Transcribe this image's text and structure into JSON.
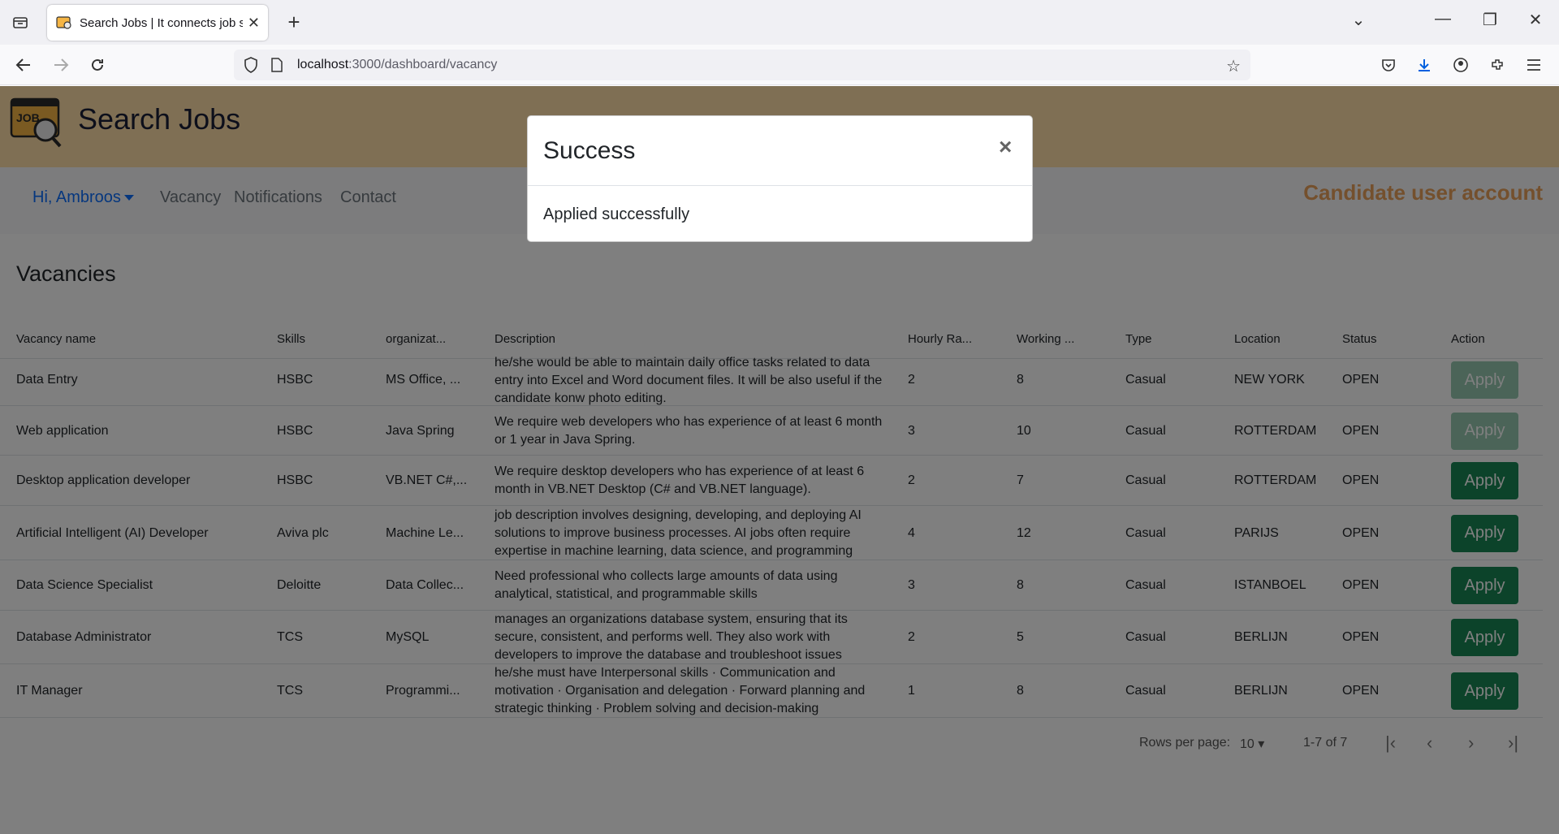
{
  "browser": {
    "tab_title": "Search Jobs | It connects job se",
    "url_host": "localhost",
    "url_path": ":3000/dashboard/vacancy"
  },
  "site": {
    "title": "Search Jobs",
    "logo_text": "JOB"
  },
  "menu": {
    "user": "Hi, Ambroos",
    "items": [
      "Vacancy",
      "Notifications",
      "Contact"
    ],
    "account_label": "Candidate user account"
  },
  "section_title": "Vacancies",
  "table": {
    "headers": [
      "Vacancy name",
      "Skills",
      "organizat...",
      "Description",
      "Hourly Ra...",
      "Working ...",
      "Type",
      "Location",
      "Status",
      "Action"
    ],
    "rows": [
      {
        "name": "Data Entry",
        "skills": "HSBC",
        "organization": "MS Office, ...",
        "description": "he/she would be able to maintain daily office tasks related to data entry into Excel and Word document files. It will be also useful if the candidate konw photo editing.",
        "rate": "2",
        "hours": "8",
        "type": "Casual",
        "location": "NEW YORK",
        "status": "OPEN",
        "action": "Apply",
        "applied": true
      },
      {
        "name": "Web application",
        "skills": "HSBC",
        "organization": "Java Spring",
        "description": "We require web developers who has experience of at least 6 month or 1 year in Java Spring.",
        "rate": "3",
        "hours": "10",
        "type": "Casual",
        "location": "ROTTERDAM",
        "status": "OPEN",
        "action": "Apply",
        "applied": true
      },
      {
        "name": "Desktop application developer",
        "skills": "HSBC",
        "organization": "VB.NET C#,...",
        "description": "We require desktop developers who has experience of at least 6 month in VB.NET Desktop (C# and VB.NET language).",
        "rate": "2",
        "hours": "7",
        "type": "Casual",
        "location": "ROTTERDAM",
        "status": "OPEN",
        "action": "Apply",
        "applied": false
      },
      {
        "name": "Artificial Intelligent (AI) Developer",
        "skills": "Aviva plc",
        "organization": "Machine Le...",
        "description": "job description involves designing, developing, and deploying AI solutions to improve business processes. AI jobs often require expertise in machine learning, data science, and programming",
        "rate": "4",
        "hours": "12",
        "type": "Casual",
        "location": "PARIJS",
        "status": "OPEN",
        "action": "Apply",
        "applied": false
      },
      {
        "name": "Data Science Specialist",
        "skills": "Deloitte",
        "organization": "Data Collec...",
        "description": "Need professional who collects large amounts of data using analytical, statistical, and programmable skills",
        "rate": "3",
        "hours": "8",
        "type": "Casual",
        "location": "ISTANBOEL",
        "status": "OPEN",
        "action": "Apply",
        "applied": false
      },
      {
        "name": "Database Administrator",
        "skills": "TCS",
        "organization": "MySQL",
        "description": "manages an organizations database system, ensuring that its secure, consistent, and performs well. They also work with developers to improve the database and troubleshoot issues",
        "rate": "2",
        "hours": "5",
        "type": "Casual",
        "location": "BERLIJN",
        "status": "OPEN",
        "action": "Apply",
        "applied": false
      },
      {
        "name": "IT Manager",
        "skills": "TCS",
        "organization": "Programmi...",
        "description": "he/she must have Interpersonal skills · Communication and motivation · Organisation and delegation · Forward planning and strategic thinking · Problem solving and decision-making",
        "rate": "1",
        "hours": "8",
        "type": "Casual",
        "location": "BERLIJN",
        "status": "OPEN",
        "action": "Apply",
        "applied": false
      }
    ]
  },
  "pagination": {
    "rows_per_page_label": "Rows per page:",
    "rows_per_page": "10",
    "range": "1-7 of 7"
  },
  "modal": {
    "title": "Success",
    "close": "×",
    "message": "Applied successfully"
  },
  "icons": {
    "tab_list": "tab-list-icon",
    "back": "back-arrow-icon",
    "forward": "forward-arrow-icon",
    "reload": "reload-icon"
  }
}
